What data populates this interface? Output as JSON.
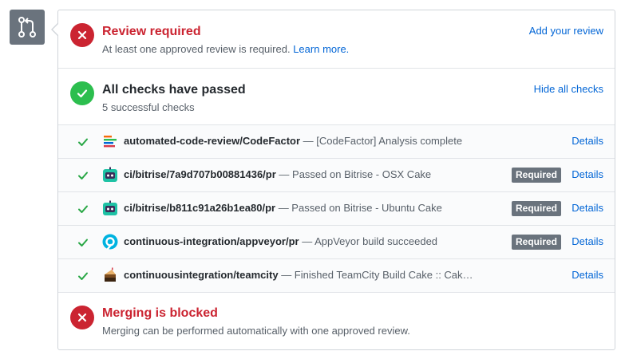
{
  "review": {
    "title": "Review required",
    "subtitle": "At least one approved review is required.",
    "learn_more": "Learn more.",
    "action": "Add your review"
  },
  "checks": {
    "title": "All checks have passed",
    "subtitle": "5 successful checks",
    "action": "Hide all checks",
    "items": [
      {
        "name": "automated-code-review/CodeFactor",
        "desc": " — [CodeFactor] Analysis complete",
        "required": "",
        "details": "Details",
        "icon": "codefactor-icon"
      },
      {
        "name": "ci/bitrise/7a9d707b00881436/pr",
        "desc": " — Passed on Bitrise - OSX Cake",
        "required": "Required",
        "details": "Details",
        "icon": "bitrise-icon"
      },
      {
        "name": "ci/bitrise/b811c91a26b1ea80/pr",
        "desc": " — Passed on Bitrise - Ubuntu Cake",
        "required": "Required",
        "details": "Details",
        "icon": "bitrise-icon"
      },
      {
        "name": "continuous-integration/appveyor/pr",
        "desc": " — AppVeyor build succeeded",
        "required": "Required",
        "details": "Details",
        "icon": "appveyor-icon"
      },
      {
        "name": "continuousintegration/teamcity",
        "desc": " — Finished TeamCity Build Cake :: Cak…",
        "required": "",
        "details": "Details",
        "icon": "cake-icon"
      }
    ]
  },
  "merge": {
    "title": "Merging is blocked",
    "subtitle": "Merging can be performed automatically with one approved review."
  },
  "colors": {
    "error": "#cb2431",
    "success": "#2cbe4e",
    "link": "#0366d6",
    "badge": "#6a737d"
  }
}
